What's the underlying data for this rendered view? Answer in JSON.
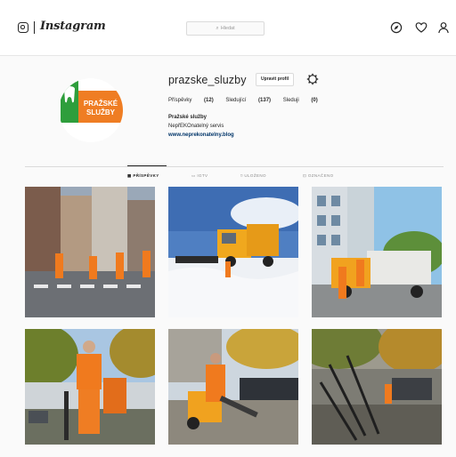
{
  "header": {
    "wordmark": "Instagram",
    "search_placeholder": "Hledat",
    "icons": [
      "instagram-camera-icon",
      "compass-icon",
      "heart-icon",
      "person-icon"
    ]
  },
  "profile": {
    "username": "prazske_sluzby",
    "edit_label": "Upravit profil",
    "logo_text_line1": "PRAŽSKÉ",
    "logo_text_line2": "SLUŽBY",
    "stats": {
      "posts_label": "Příspěvky",
      "posts_value": "(12)",
      "followers_label": "Sledující",
      "followers_value": "(137)",
      "following_label": "Sleduji",
      "following_value": "(0)"
    },
    "bio_name": "Pražské služby",
    "bio_line": "NepřEKOnatelný servis",
    "bio_link": "www.neprekonatelny.blog"
  },
  "tabs": [
    {
      "label": "PŘÍSPĚVKY",
      "active": true
    },
    {
      "label": "IGTV",
      "active": false
    },
    {
      "label": "ULOŽENO",
      "active": false
    },
    {
      "label": "OZNAČENO",
      "active": false
    }
  ],
  "colors": {
    "brand_green": "#2e9e3c",
    "brand_orange": "#ef7d23",
    "link": "#003569"
  },
  "posts": [
    {
      "scene": "street-crosswalk-workers"
    },
    {
      "scene": "snow-plow-truck"
    },
    {
      "scene": "garbage-truck-apartments"
    },
    {
      "scene": "leaf-blower-worker"
    },
    {
      "scene": "leaf-vacuum-cart"
    },
    {
      "scene": "street-sweeping-autumn"
    }
  ]
}
